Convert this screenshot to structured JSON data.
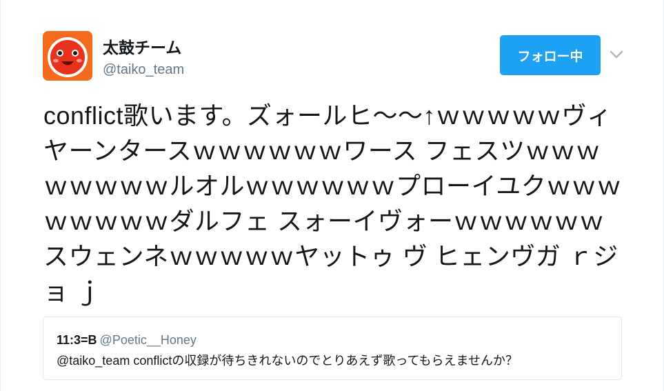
{
  "author": {
    "display_name": "太鼓チーム",
    "handle": "@taiko_team",
    "avatar_icon": "taiko-drum-mascot-icon"
  },
  "follow_button": {
    "label": "フォロー中",
    "color": "#1da1f2"
  },
  "caret_icon": "chevron-down-icon",
  "tweet": {
    "text": "conflict歌います。ズォールヒ～～↑ｗｗｗｗｗヴィヤーンタースｗｗｗｗｗｗワース フェスツｗｗｗｗｗｗｗｗルオルｗｗｗｗｗｗプローイユクｗｗｗｗｗｗｗｗダルフェ スォーイヴォーｗｗｗｗｗｗスウェンネｗｗｗｗｗヤットゥ ヴ ヒェンヴガ ｒジョ ｊ"
  },
  "quoted_tweet": {
    "display_name": "11:3=B",
    "handle": "@Poetic__Honey",
    "text": "@taiko_team conflictの収録が待ちきれないのでとりあえず歌ってもらえませんか？"
  }
}
